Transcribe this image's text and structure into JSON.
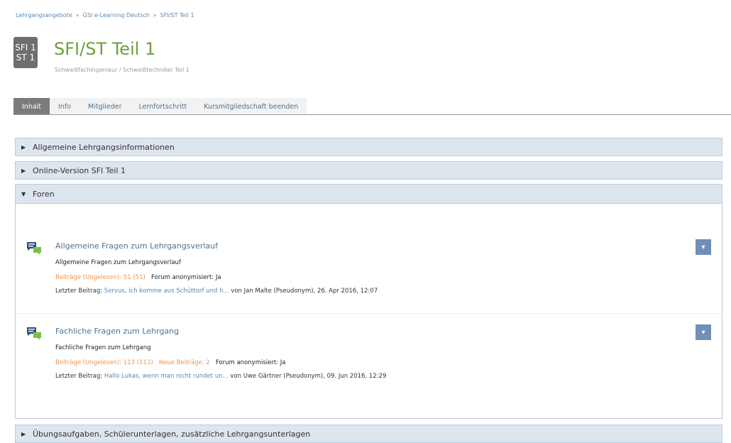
{
  "breadcrumb": {
    "items": [
      "Lehrgangsangebote",
      "GSI e-Learning Deutsch",
      "SFI/ST Teil 1"
    ],
    "separator": "»"
  },
  "course": {
    "icon_text_line1": "SFI 1",
    "icon_text_line2": "ST 1",
    "title": "SFI/ST Teil 1",
    "subtitle": "Schweißfachingenieur / Schweißtechniker Teil 1"
  },
  "tabs": [
    {
      "label": "Inhalt",
      "active": true
    },
    {
      "label": "Info",
      "active": false
    },
    {
      "label": "Mitglieder",
      "active": false
    },
    {
      "label": "Lernfortschritt",
      "active": false
    },
    {
      "label": "Kursmitgliedschaft beenden",
      "active": false
    }
  ],
  "sections": {
    "allgemeine": {
      "label": "Allgemeine Lehrgangsinformationen",
      "expanded": false
    },
    "online": {
      "label": "Online-Version SFI Teil 1",
      "expanded": false
    },
    "foren": {
      "label": "Foren",
      "expanded": true
    },
    "uebungen": {
      "label": "Übungsaufgaben, Schülerunterlagen, zusätzliche Lehrgangsunterlagen",
      "expanded": false
    }
  },
  "forums": [
    {
      "title": "Allgemeine Fragen zum Lehrgangsverlauf",
      "description": "Allgemeine Fragen zum Lehrgangsverlauf",
      "posts_unread": "Beiträge (Ungelesen): 51 (51)",
      "new_posts": "",
      "anonymized": "Forum anonymisiert: Ja",
      "last_post_label": "Letzter Beitrag:",
      "last_post_link": "Servus, ich komme aus Schüttorf und h...",
      "last_post_meta": "von Jan Malte (Pseudonym), 26. Apr 2016, 12:07"
    },
    {
      "title": "Fachliche Fragen zum Lehrgang",
      "description": "Fachliche Fragen zum Lehrgang",
      "posts_unread": "Beiträge (Ungelesen): 113 (113)",
      "new_posts": "Neue Beiträge: 2",
      "anonymized": "Forum anonymisiert: Ja",
      "last_post_label": "Letzter Beitrag:",
      "last_post_link": "Hallo Lukas, wenn man nicht rundet un...",
      "last_post_meta": "von Uwe Gärtner (Pseudonym), 09. Jun 2016, 12:29"
    }
  ],
  "icons": {
    "collapsed": "▶",
    "expanded": "▼",
    "forum": "forum-icon",
    "menu": "▾"
  },
  "colors": {
    "accent_green": "#6f9e3c",
    "link_blue": "#4f7290",
    "orange": "#f1944a",
    "section_bg": "#dde5ef",
    "menu_button": "#6f8fb6"
  }
}
